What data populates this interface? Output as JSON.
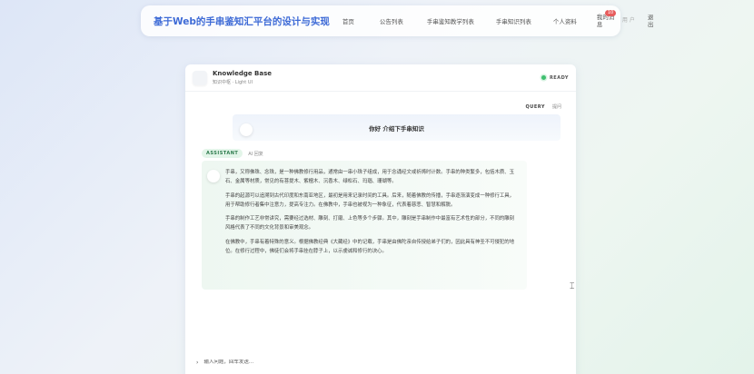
{
  "nav": {
    "brand": "基于Web的手串鉴知汇平台的设计与实现",
    "links": [
      "首页",
      "公告列表",
      "手串鉴知教学列表",
      "手串知识列表",
      "个人资料"
    ],
    "message_label": "我的消息",
    "message_badge": "10",
    "user_label": "用户",
    "logout_label": "退出"
  },
  "panel": {
    "title": "Knowledge Base",
    "subtitle": "知识中枢 · Light UI",
    "status": "READY",
    "query_tag": "QUERY",
    "query_sub": "提问",
    "query_text": "你好 介绍下手串知识",
    "assistant_tag": "ASSISTANT",
    "assistant_sub": "AI 回复",
    "answer": [
      "手串，又称佛珠、念珠，是一种佛教修行用品，通常由一串小珠子组成，用于念诵经文或祈祷时计数。手串的种类繁多，包括木质、玉石、金属等材质，常见的有菩提木、紫檀木、沉香木、绿松石、玛瑙、珊瑚等。",
      "手串的起源可以追溯到古代印度和东南亚地区，最初是用来记录时间的工具。后来，随着佛教的传播，手串逐渐演变成一种修行工具，用于帮助修行者集中注意力，提高专注力。在佛教中，手串也被视为一种象征，代表着慈悲、智慧和解脱。",
      "手串的制作工艺非常讲究，需要经过选材、雕刻、打磨、上色等多个步骤。其中，雕刻是手串制作中最富有艺术性的部分，不同的雕刻风格代表了不同的文化背景和审美观念。",
      "在佛教中，手串有着特殊的意义。根据佛教经典《大藏经》中的记载，手串是由佛陀亲自传授给弟子们的，因此具有神圣不可侵犯的地位。在修行过程中，佛徒们会将手串挂在脖子上，以示虔诚和修行的决心。"
    ],
    "input_placeholder": "输入问题，回车发送..."
  },
  "colors": {
    "brand": "#3d6ad6",
    "ready_dot": "#3fbf6f",
    "badge": "#e75c5c"
  },
  "icons": {
    "input_prompt": "chevron-right-icon",
    "cursor": "mouse-cursor-icon"
  }
}
